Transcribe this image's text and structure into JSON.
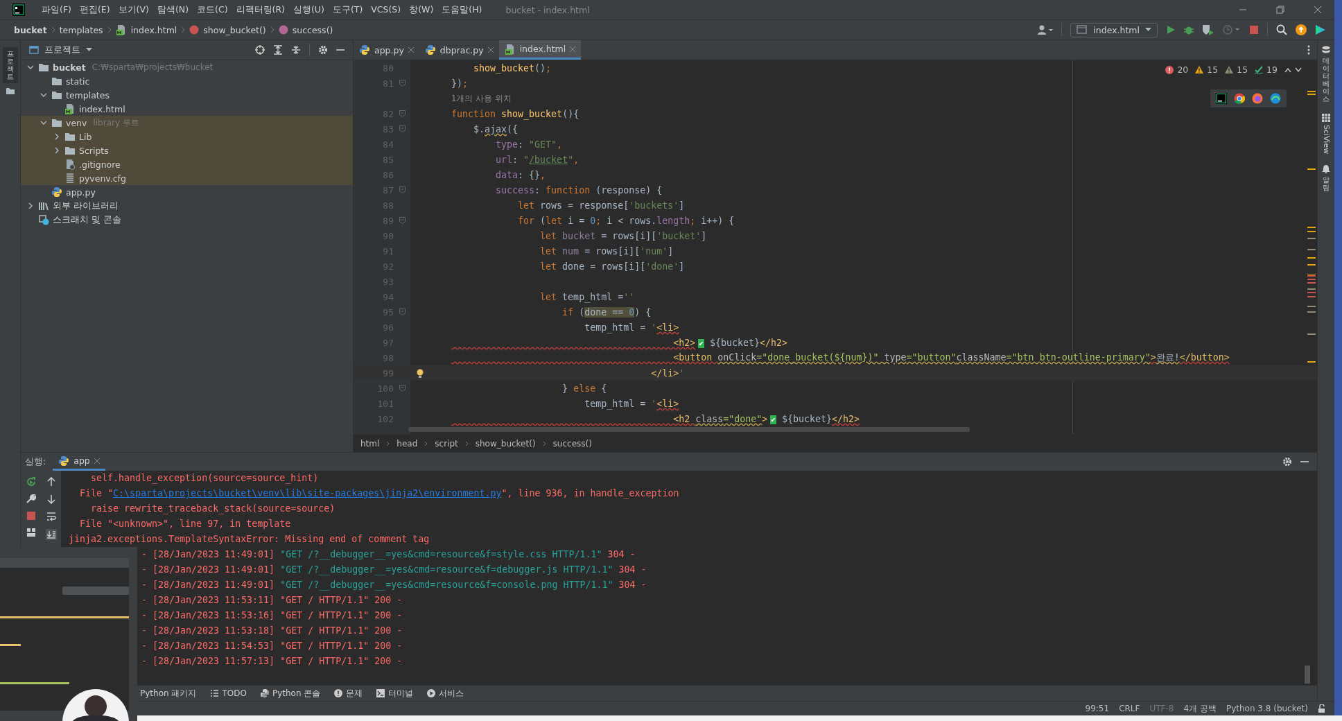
{
  "window": {
    "title": "bucket - index.html",
    "menu": [
      "파일(F)",
      "편집(E)",
      "보기(V)",
      "탐색(N)",
      "코드(C)",
      "리팩터링(R)",
      "실행(U)",
      "도구(T)",
      "VCS(S)",
      "창(W)",
      "도움말(H)"
    ]
  },
  "nav_bar": {
    "breadcrumbs": [
      {
        "label": "bucket",
        "kind": "project"
      },
      {
        "label": "templates",
        "kind": "folder"
      },
      {
        "label": "index.html",
        "kind": "html"
      },
      {
        "label": "show_bucket()",
        "kind": "function"
      },
      {
        "label": "success()",
        "kind": "method"
      }
    ],
    "run_config": "index.html"
  },
  "left_strip": {
    "label": "프로젝트"
  },
  "project_panel": {
    "title": "프로젝트",
    "tree": [
      {
        "label": "bucket",
        "hint": "C:₩sparta₩projects₩bucket",
        "kind": "folder",
        "bold": true,
        "expanded": true,
        "highlighted": false,
        "children": [
          {
            "label": "static",
            "kind": "folder",
            "highlighted": false
          },
          {
            "label": "templates",
            "kind": "folder",
            "expanded": true,
            "highlighted": false,
            "children": [
              {
                "label": "index.html",
                "kind": "html",
                "highlighted": false
              }
            ]
          },
          {
            "label": "venv",
            "hint": "library 루트",
            "kind": "folder",
            "expanded": true,
            "highlighted": true,
            "children": [
              {
                "label": "Lib",
                "kind": "folder",
                "expanded": false,
                "highlighted": true
              },
              {
                "label": "Scripts",
                "kind": "folder",
                "expanded": false,
                "highlighted": true
              },
              {
                "label": ".gitignore",
                "kind": "ignore",
                "highlighted": true
              },
              {
                "label": "pyvenv.cfg",
                "kind": "text",
                "highlighted": true
              }
            ]
          },
          {
            "label": "app.py",
            "kind": "python",
            "highlighted": false
          }
        ]
      },
      {
        "label": "외부 라이브러리",
        "kind": "library",
        "expanded": false,
        "highlighted": false
      },
      {
        "label": "스크래치 및 콘솔",
        "kind": "scratch",
        "highlighted": false
      }
    ]
  },
  "editor": {
    "tabs": [
      {
        "label": "app.py",
        "kind": "python",
        "selected": false
      },
      {
        "label": "dbprac.py",
        "kind": "python",
        "selected": false
      },
      {
        "label": "index.html",
        "kind": "html",
        "selected": true
      }
    ],
    "problems": [
      {
        "kind": "error",
        "count": "20"
      },
      {
        "kind": "warning",
        "count": "15"
      },
      {
        "kind": "weak",
        "count": "15"
      },
      {
        "kind": "typo",
        "count": "19"
      }
    ],
    "lines": [
      {
        "number": "80",
        "fold": false,
        "current": false,
        "tokens": [
          {
            "kind": "fn",
            "text": "    show_bucket"
          },
          {
            "kind": "p",
            "text": "()"
          },
          {
            "kind": "kw",
            "text": ";"
          }
        ]
      },
      {
        "number": "81",
        "fold": true,
        "current": false,
        "tokens": [
          {
            "kind": "p",
            "text": "})"
          },
          {
            "kind": "kw",
            "text": ";"
          }
        ]
      },
      {
        "kind": "hint",
        "text": "1개의 사용 위치"
      },
      {
        "number": "82",
        "fold": true,
        "current": false,
        "tokens": [
          {
            "kind": "kw",
            "text": "function "
          },
          {
            "kind": "fn",
            "text": "show_bucket"
          },
          {
            "kind": "p",
            "text": "(){"
          }
        ]
      },
      {
        "number": "83",
        "fold": true,
        "current": false,
        "tokens": [
          {
            "kind": "p",
            "text": "    $."
          },
          {
            "kind": "pw",
            "text": "ajax"
          },
          {
            "kind": "p",
            "text": "({"
          }
        ]
      },
      {
        "number": "84",
        "fold": false,
        "current": false,
        "tokens": [
          {
            "kind": "prop",
            "text": "        type"
          },
          {
            "kind": "p",
            "text": ": "
          },
          {
            "kind": "str",
            "text": "\"GET\""
          },
          {
            "kind": "kw",
            "text": ","
          }
        ]
      },
      {
        "number": "85",
        "fold": false,
        "current": false,
        "tokens": [
          {
            "kind": "prop",
            "text": "        url"
          },
          {
            "kind": "p",
            "text": ": "
          },
          {
            "kind": "str",
            "text": "\""
          },
          {
            "kind": "strlink",
            "text": "/bucket"
          },
          {
            "kind": "str",
            "text": "\""
          },
          {
            "kind": "kw",
            "text": ","
          }
        ]
      },
      {
        "number": "86",
        "fold": false,
        "current": false,
        "tokens": [
          {
            "kind": "prop",
            "text": "        data"
          },
          {
            "kind": "p",
            "text": ": {}"
          },
          {
            "kind": "kw",
            "text": ","
          }
        ]
      },
      {
        "number": "87",
        "fold": true,
        "current": false,
        "tokens": [
          {
            "kind": "prop",
            "text": "        success"
          },
          {
            "kind": "p",
            "text": ": "
          },
          {
            "kind": "kw",
            "text": "function "
          },
          {
            "kind": "p",
            "text": "(response) {"
          }
        ]
      },
      {
        "number": "88",
        "fold": false,
        "current": false,
        "tokens": [
          {
            "kind": "kw",
            "text": "            let "
          },
          {
            "kind": "p",
            "text": "rows = response["
          },
          {
            "kind": "str",
            "text": "'buckets'"
          },
          {
            "kind": "p",
            "text": "]"
          }
        ]
      },
      {
        "number": "89",
        "fold": true,
        "current": false,
        "tokens": [
          {
            "kind": "kw",
            "text": "            for "
          },
          {
            "kind": "p",
            "text": "("
          },
          {
            "kind": "kw",
            "text": "let "
          },
          {
            "kind": "p",
            "text": "i = "
          },
          {
            "kind": "num",
            "text": "0"
          },
          {
            "kind": "kw",
            "text": "; "
          },
          {
            "kind": "p",
            "text": "i < rows."
          },
          {
            "kind": "prop",
            "text": "length"
          },
          {
            "kind": "kw",
            "text": "; "
          },
          {
            "kind": "p",
            "text": "i++) {"
          }
        ]
      },
      {
        "number": "90",
        "fold": false,
        "current": false,
        "tokens": [
          {
            "kind": "kw",
            "text": "                let "
          },
          {
            "kind": "unused",
            "text": "bucket"
          },
          {
            "kind": "p",
            "text": " = rows[i]["
          },
          {
            "kind": "str",
            "text": "'bucket'"
          },
          {
            "kind": "p",
            "text": "]"
          }
        ]
      },
      {
        "number": "91",
        "fold": false,
        "current": false,
        "tokens": [
          {
            "kind": "kw",
            "text": "                let "
          },
          {
            "kind": "unused",
            "text": "num"
          },
          {
            "kind": "p",
            "text": " = rows[i]["
          },
          {
            "kind": "str",
            "text": "'num'"
          },
          {
            "kind": "p",
            "text": "]"
          }
        ]
      },
      {
        "number": "92",
        "fold": false,
        "current": false,
        "tokens": [
          {
            "kind": "kw",
            "text": "                let "
          },
          {
            "kind": "p",
            "text": "done = rows[i]["
          },
          {
            "kind": "str",
            "text": "'done'"
          },
          {
            "kind": "p",
            "text": "]"
          }
        ]
      },
      {
        "number": "93",
        "fold": false,
        "current": false
      },
      {
        "number": "94",
        "fold": false,
        "current": false,
        "tokens": [
          {
            "kind": "kw",
            "text": "                let "
          },
          {
            "kind": "p",
            "text": "temp_html ="
          },
          {
            "kind": "str",
            "text": "''"
          }
        ]
      },
      {
        "number": "95",
        "fold": true,
        "current": false,
        "tokens": [
          {
            "kind": "kw",
            "text": "                    if "
          },
          {
            "kind": "p",
            "text": "("
          },
          {
            "kind": "hl",
            "text": "done == "
          },
          {
            "kind": "hln",
            "text": "0"
          },
          {
            "kind": "p",
            "text": ") {"
          }
        ]
      },
      {
        "number": "96",
        "fold": false,
        "current": false,
        "tokens": [
          {
            "kind": "p",
            "text": "                        temp_html = "
          },
          {
            "kind": "str",
            "text": "'"
          },
          {
            "kind": "tagw",
            "text": "<li>"
          }
        ]
      },
      {
        "number": "97",
        "fold": false,
        "current": false,
        "tokens": [
          {
            "kind": "tagw",
            "text": "                                        <h2>"
          },
          {
            "kind": "emoji",
            "text": "✔"
          },
          {
            "kind": "p",
            "text": " ${bucket}"
          },
          {
            "kind": "tag",
            "text": "</h2>"
          }
        ]
      },
      {
        "number": "98",
        "fold": false,
        "current": false,
        "tokens": [
          {
            "kind": "tagw",
            "text": "                                        <button "
          },
          {
            "kind": "attrw",
            "text": "onClick"
          },
          {
            "kind": "valw",
            "text": "=\"done_bucket(${num})\""
          },
          {
            "kind": "attrw",
            "text": " type"
          },
          {
            "kind": "valw",
            "text": "=\"button\""
          },
          {
            "kind": "attrw",
            "text": "className"
          },
          {
            "kind": "valw",
            "text": "=\"btn btn-outline-primary\""
          },
          {
            "kind": "tagw",
            "text": ">"
          },
          {
            "kind": "pw",
            "text": "완료!"
          },
          {
            "kind": "tagw",
            "text": "</button>"
          }
        ]
      },
      {
        "number": "99",
        "fold": false,
        "current": true,
        "tokens": [
          {
            "kind": "tag",
            "text": "                                    </li>"
          },
          {
            "kind": "str",
            "text": "'"
          }
        ]
      },
      {
        "number": "100",
        "fold": true,
        "current": false,
        "tokens": [
          {
            "kind": "p",
            "text": "                    } "
          },
          {
            "kind": "kw",
            "text": "else "
          },
          {
            "kind": "p",
            "text": "{"
          }
        ]
      },
      {
        "number": "101",
        "fold": false,
        "current": false,
        "tokens": [
          {
            "kind": "p",
            "text": "                        temp_html = "
          },
          {
            "kind": "str",
            "text": "'"
          },
          {
            "kind": "tagw",
            "text": "<li>"
          }
        ]
      },
      {
        "number": "102",
        "fold": false,
        "current": false,
        "tokens": [
          {
            "kind": "tagw",
            "text": "                                        <h2 "
          },
          {
            "kind": "attrw",
            "text": "class"
          },
          {
            "kind": "valw",
            "text": "=\"done\""
          },
          {
            "kind": "tag",
            "text": ">"
          },
          {
            "kind": "emoji",
            "text": "✔"
          },
          {
            "kind": "p",
            "text": " ${bucket}"
          },
          {
            "kind": "tagw",
            "text": "</h2>"
          }
        ]
      }
    ],
    "breadcrumbs": [
      "html",
      "head",
      "script",
      "show_bucket()",
      "success()"
    ]
  },
  "run_panel": {
    "label": "실행:",
    "tabs": [
      {
        "label": "app",
        "selected": true
      }
    ],
    "console": [
      {
        "kind": "trace",
        "tokens": [
          {
            "kind": "err",
            "text": "    self.handle_exception(source=source_hint)"
          }
        ]
      },
      {
        "kind": "trace",
        "tokens": [
          {
            "kind": "err",
            "text": "  File \""
          },
          {
            "kind": "link",
            "text": "C:\\sparta\\projects\\bucket\\venv\\lib\\site-packages\\jinja2\\environment.py"
          },
          {
            "kind": "err",
            "text": "\", line 936, in handle_exception"
          }
        ]
      },
      {
        "kind": "trace",
        "tokens": [
          {
            "kind": "err",
            "text": "    raise rewrite_traceback_stack(source=source)"
          }
        ]
      },
      {
        "kind": "trace",
        "tokens": [
          {
            "kind": "err",
            "text": "  File \"<unknown>\", line 97, in template"
          }
        ]
      },
      {
        "kind": "trace",
        "tokens": [
          {
            "kind": "err",
            "text": "jinja2.exceptions.TemplateSyntaxError: Missing end of comment tag"
          }
        ]
      },
      {
        "kind": "log",
        "tokens": [
          {
            "kind": "err",
            "text": "- [28/Jan/2023 11:49:01] "
          },
          {
            "kind": "ok",
            "text": "\"GET /?__debugger__=yes&cmd=resource&f=style.css HTTP/1.1\""
          },
          {
            "kind": "err",
            "text": " 304 -"
          }
        ]
      },
      {
        "kind": "log",
        "tokens": [
          {
            "kind": "err",
            "text": "- [28/Jan/2023 11:49:01] "
          },
          {
            "kind": "ok",
            "text": "\"GET /?__debugger__=yes&cmd=resource&f=debugger.js HTTP/1.1\""
          },
          {
            "kind": "err",
            "text": " 304 -"
          }
        ]
      },
      {
        "kind": "log",
        "tokens": [
          {
            "kind": "err",
            "text": "- [28/Jan/2023 11:49:01] "
          },
          {
            "kind": "ok",
            "text": "\"GET /?__debugger__=yes&cmd=resource&f=console.png HTTP/1.1\""
          },
          {
            "kind": "err",
            "text": " 304 -"
          }
        ]
      },
      {
        "kind": "log",
        "tokens": [
          {
            "kind": "err",
            "text": "- [28/Jan/2023 11:53:11] \"GET / HTTP/1.1\" 200 -"
          }
        ]
      },
      {
        "kind": "log",
        "tokens": [
          {
            "kind": "err",
            "text": "- [28/Jan/2023 11:53:16] \"GET / HTTP/1.1\" 200 -"
          }
        ]
      },
      {
        "kind": "log",
        "tokens": [
          {
            "kind": "err",
            "text": "- [28/Jan/2023 11:53:18] \"GET / HTTP/1.1\" 200 -"
          }
        ]
      },
      {
        "kind": "log",
        "tokens": [
          {
            "kind": "err",
            "text": "- [28/Jan/2023 11:54:53] \"GET / HTTP/1.1\" 200 -"
          }
        ]
      },
      {
        "kind": "log",
        "tokens": [
          {
            "kind": "err",
            "text": "- [28/Jan/2023 11:57:13] \"GET / HTTP/1.1\" 200 -"
          }
        ]
      }
    ]
  },
  "tool_tabs": [
    {
      "label": "Python 패키지",
      "kind": "none"
    },
    {
      "label": "TODO",
      "kind": "list"
    },
    {
      "label": "Python 콘솔",
      "kind": "python"
    },
    {
      "label": "문제",
      "kind": "problem"
    },
    {
      "label": "터미널",
      "kind": "terminal"
    },
    {
      "label": "서비스",
      "kind": "service"
    }
  ],
  "status_bar": [
    {
      "text": "99:51",
      "disabled": false
    },
    {
      "text": "CRLF",
      "disabled": false
    },
    {
      "text": "UTF-8",
      "disabled": true
    },
    {
      "text": "4개 공백",
      "disabled": false
    },
    {
      "text": "Python 3.8 (bucket)",
      "disabled": false
    }
  ],
  "right_strip": [
    {
      "label": "데이터베이스",
      "kind": "database"
    },
    {
      "label": "SciView",
      "kind": "sciview"
    },
    {
      "label": "알림",
      "kind": "bell"
    }
  ]
}
